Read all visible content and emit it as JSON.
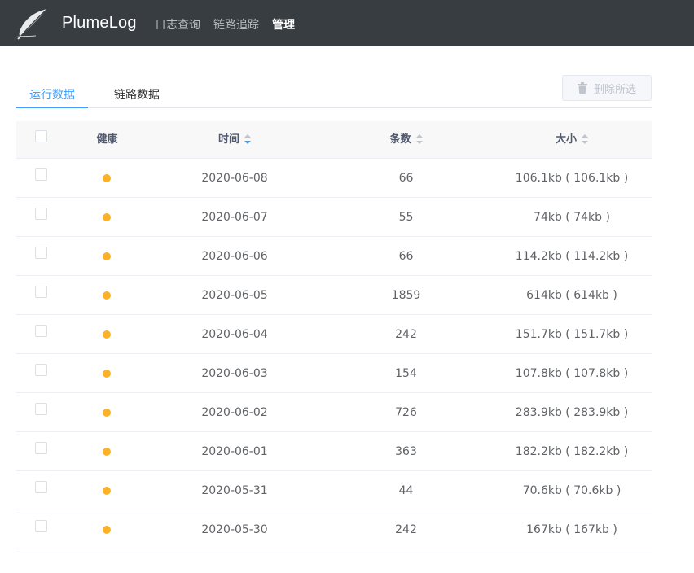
{
  "header": {
    "brand": "PlumeLog",
    "nav": [
      {
        "label": "日志查询",
        "active": false
      },
      {
        "label": "链路追踪",
        "active": false
      },
      {
        "label": "管理",
        "active": true
      }
    ]
  },
  "tabs": [
    {
      "label": "运行数据",
      "active": true
    },
    {
      "label": "链路数据",
      "active": false
    }
  ],
  "toolbar": {
    "delete_label": "删除所选",
    "delete_icon": "trash-icon"
  },
  "table": {
    "columns": [
      {
        "label": "健康",
        "sortable": false
      },
      {
        "label": "时间",
        "sortable": true,
        "sort": "desc"
      },
      {
        "label": "条数",
        "sortable": true
      },
      {
        "label": "大小",
        "sortable": true
      }
    ],
    "health_color": "#fdb12a",
    "rows": [
      {
        "date": "2020-06-08",
        "count": "66",
        "size": "106.1kb ( 106.1kb )"
      },
      {
        "date": "2020-06-07",
        "count": "55",
        "size": "74kb ( 74kb )"
      },
      {
        "date": "2020-06-06",
        "count": "66",
        "size": "114.2kb ( 114.2kb )"
      },
      {
        "date": "2020-06-05",
        "count": "1859",
        "size": "614kb ( 614kb )"
      },
      {
        "date": "2020-06-04",
        "count": "242",
        "size": "151.7kb ( 151.7kb )"
      },
      {
        "date": "2020-06-03",
        "count": "154",
        "size": "107.8kb ( 107.8kb )"
      },
      {
        "date": "2020-06-02",
        "count": "726",
        "size": "283.9kb ( 283.9kb )"
      },
      {
        "date": "2020-06-01",
        "count": "363",
        "size": "182.2kb ( 182.2kb )"
      },
      {
        "date": "2020-05-31",
        "count": "44",
        "size": "70.6kb ( 70.6kb )"
      },
      {
        "date": "2020-05-30",
        "count": "242",
        "size": "167kb ( 167kb )"
      }
    ]
  },
  "colors": {
    "accent": "#409eff",
    "topbar": "#373d41"
  }
}
